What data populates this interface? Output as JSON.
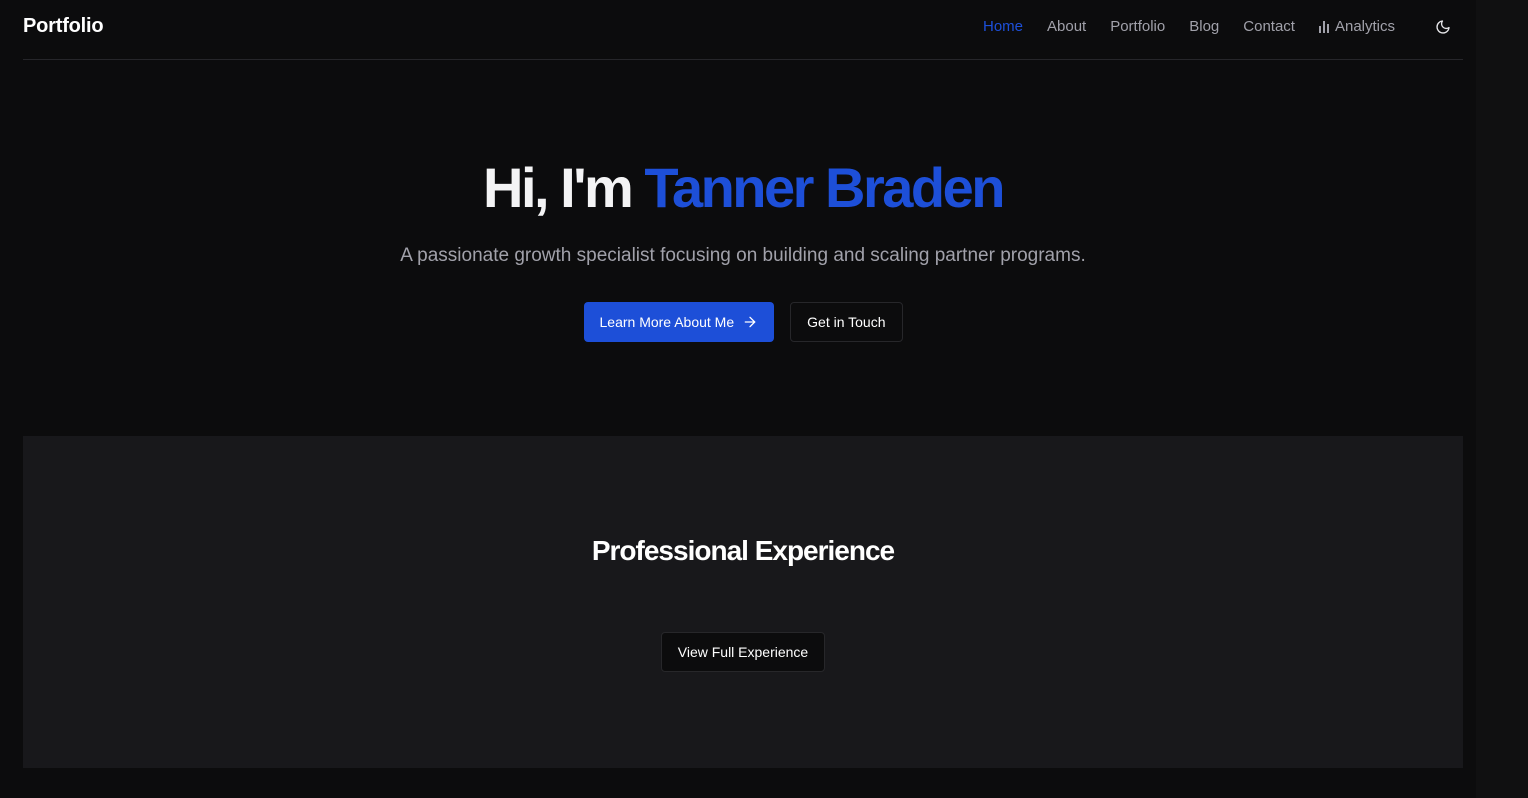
{
  "header": {
    "brand": "Portfolio",
    "nav": {
      "home": "Home",
      "about": "About",
      "portfolio": "Portfolio",
      "blog": "Blog",
      "contact": "Contact",
      "analytics": "Analytics"
    },
    "active": "Home",
    "theme_icon": "moon-icon"
  },
  "hero": {
    "greeting": "Hi, I'm ",
    "name": "Tanner Braden",
    "subtitle": "A passionate growth specialist focusing on building and scaling partner programs.",
    "primary_button": "Learn More About Me",
    "secondary_button": "Get in Touch"
  },
  "experience": {
    "title": "Professional Experience",
    "button": "View Full Experience"
  },
  "colors": {
    "accent": "#1d4fd8",
    "background": "#0c0c0d",
    "section_background": "#18181b",
    "muted_text": "#a1a1aa"
  }
}
